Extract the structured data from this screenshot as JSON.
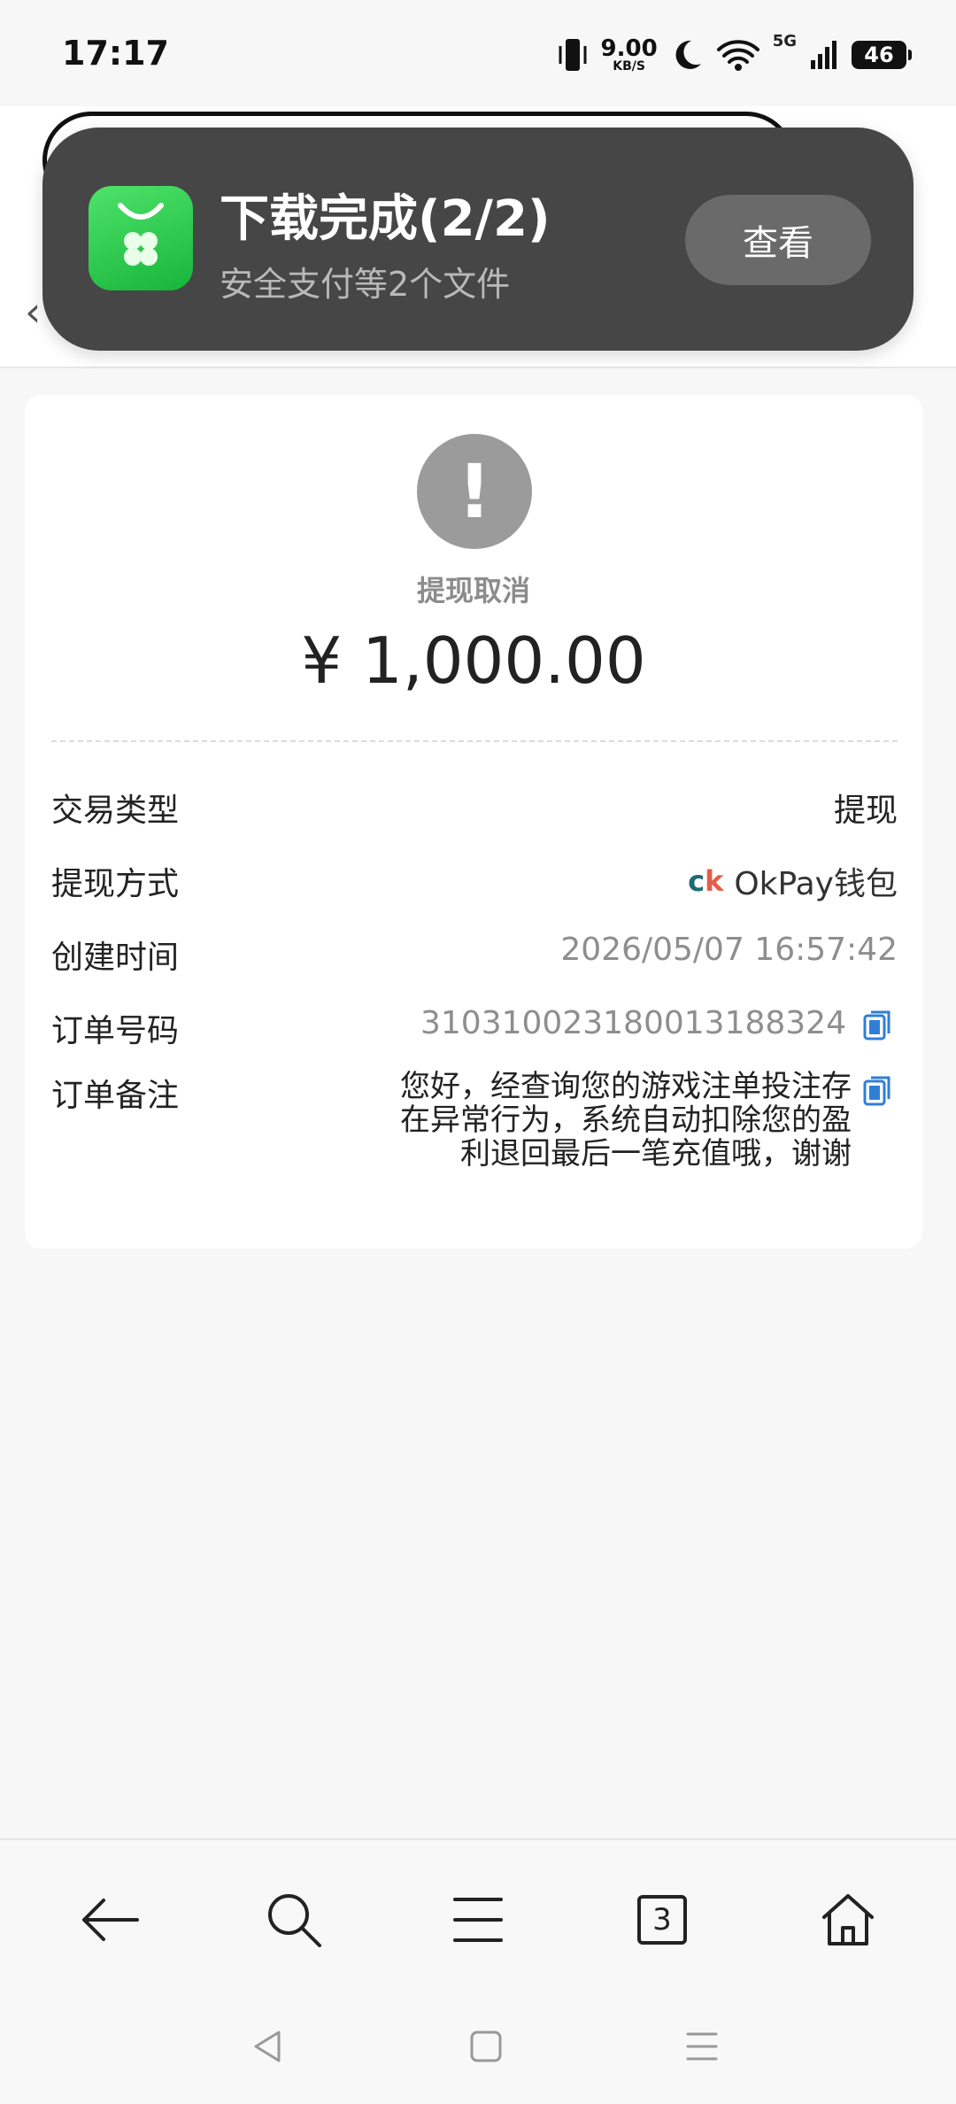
{
  "status_bar": {
    "time": "17:17",
    "net_speed": "9.00",
    "net_unit": "KB/S",
    "network": "5G",
    "battery": "46"
  },
  "notification": {
    "title": "下载完成(2/2)",
    "subtitle": "安全支付等2个文件",
    "action": "查看"
  },
  "record": {
    "status": "提现取消",
    "amount": "¥ 1,000.00",
    "rows": [
      {
        "label": "交易类型",
        "value": "提现"
      },
      {
        "label": "提现方式",
        "value": "OkPay钱包"
      },
      {
        "label": "创建时间",
        "value": "2026/05/07 16:57:42"
      },
      {
        "label": "订单号码",
        "value": "310310023180013188324"
      },
      {
        "label": "订单备注",
        "value": "您好，经查询您的游戏注单投注存在异常行为，系统自动扣除您的盈利退回最后一笔充值哦，谢谢"
      }
    ]
  },
  "bottom_bar": {
    "tabs_count": "3"
  },
  "colors": {
    "accent_blue": "#2f7fd6",
    "notification_bg": "#464646",
    "status_gray": "#9b9b9b"
  }
}
